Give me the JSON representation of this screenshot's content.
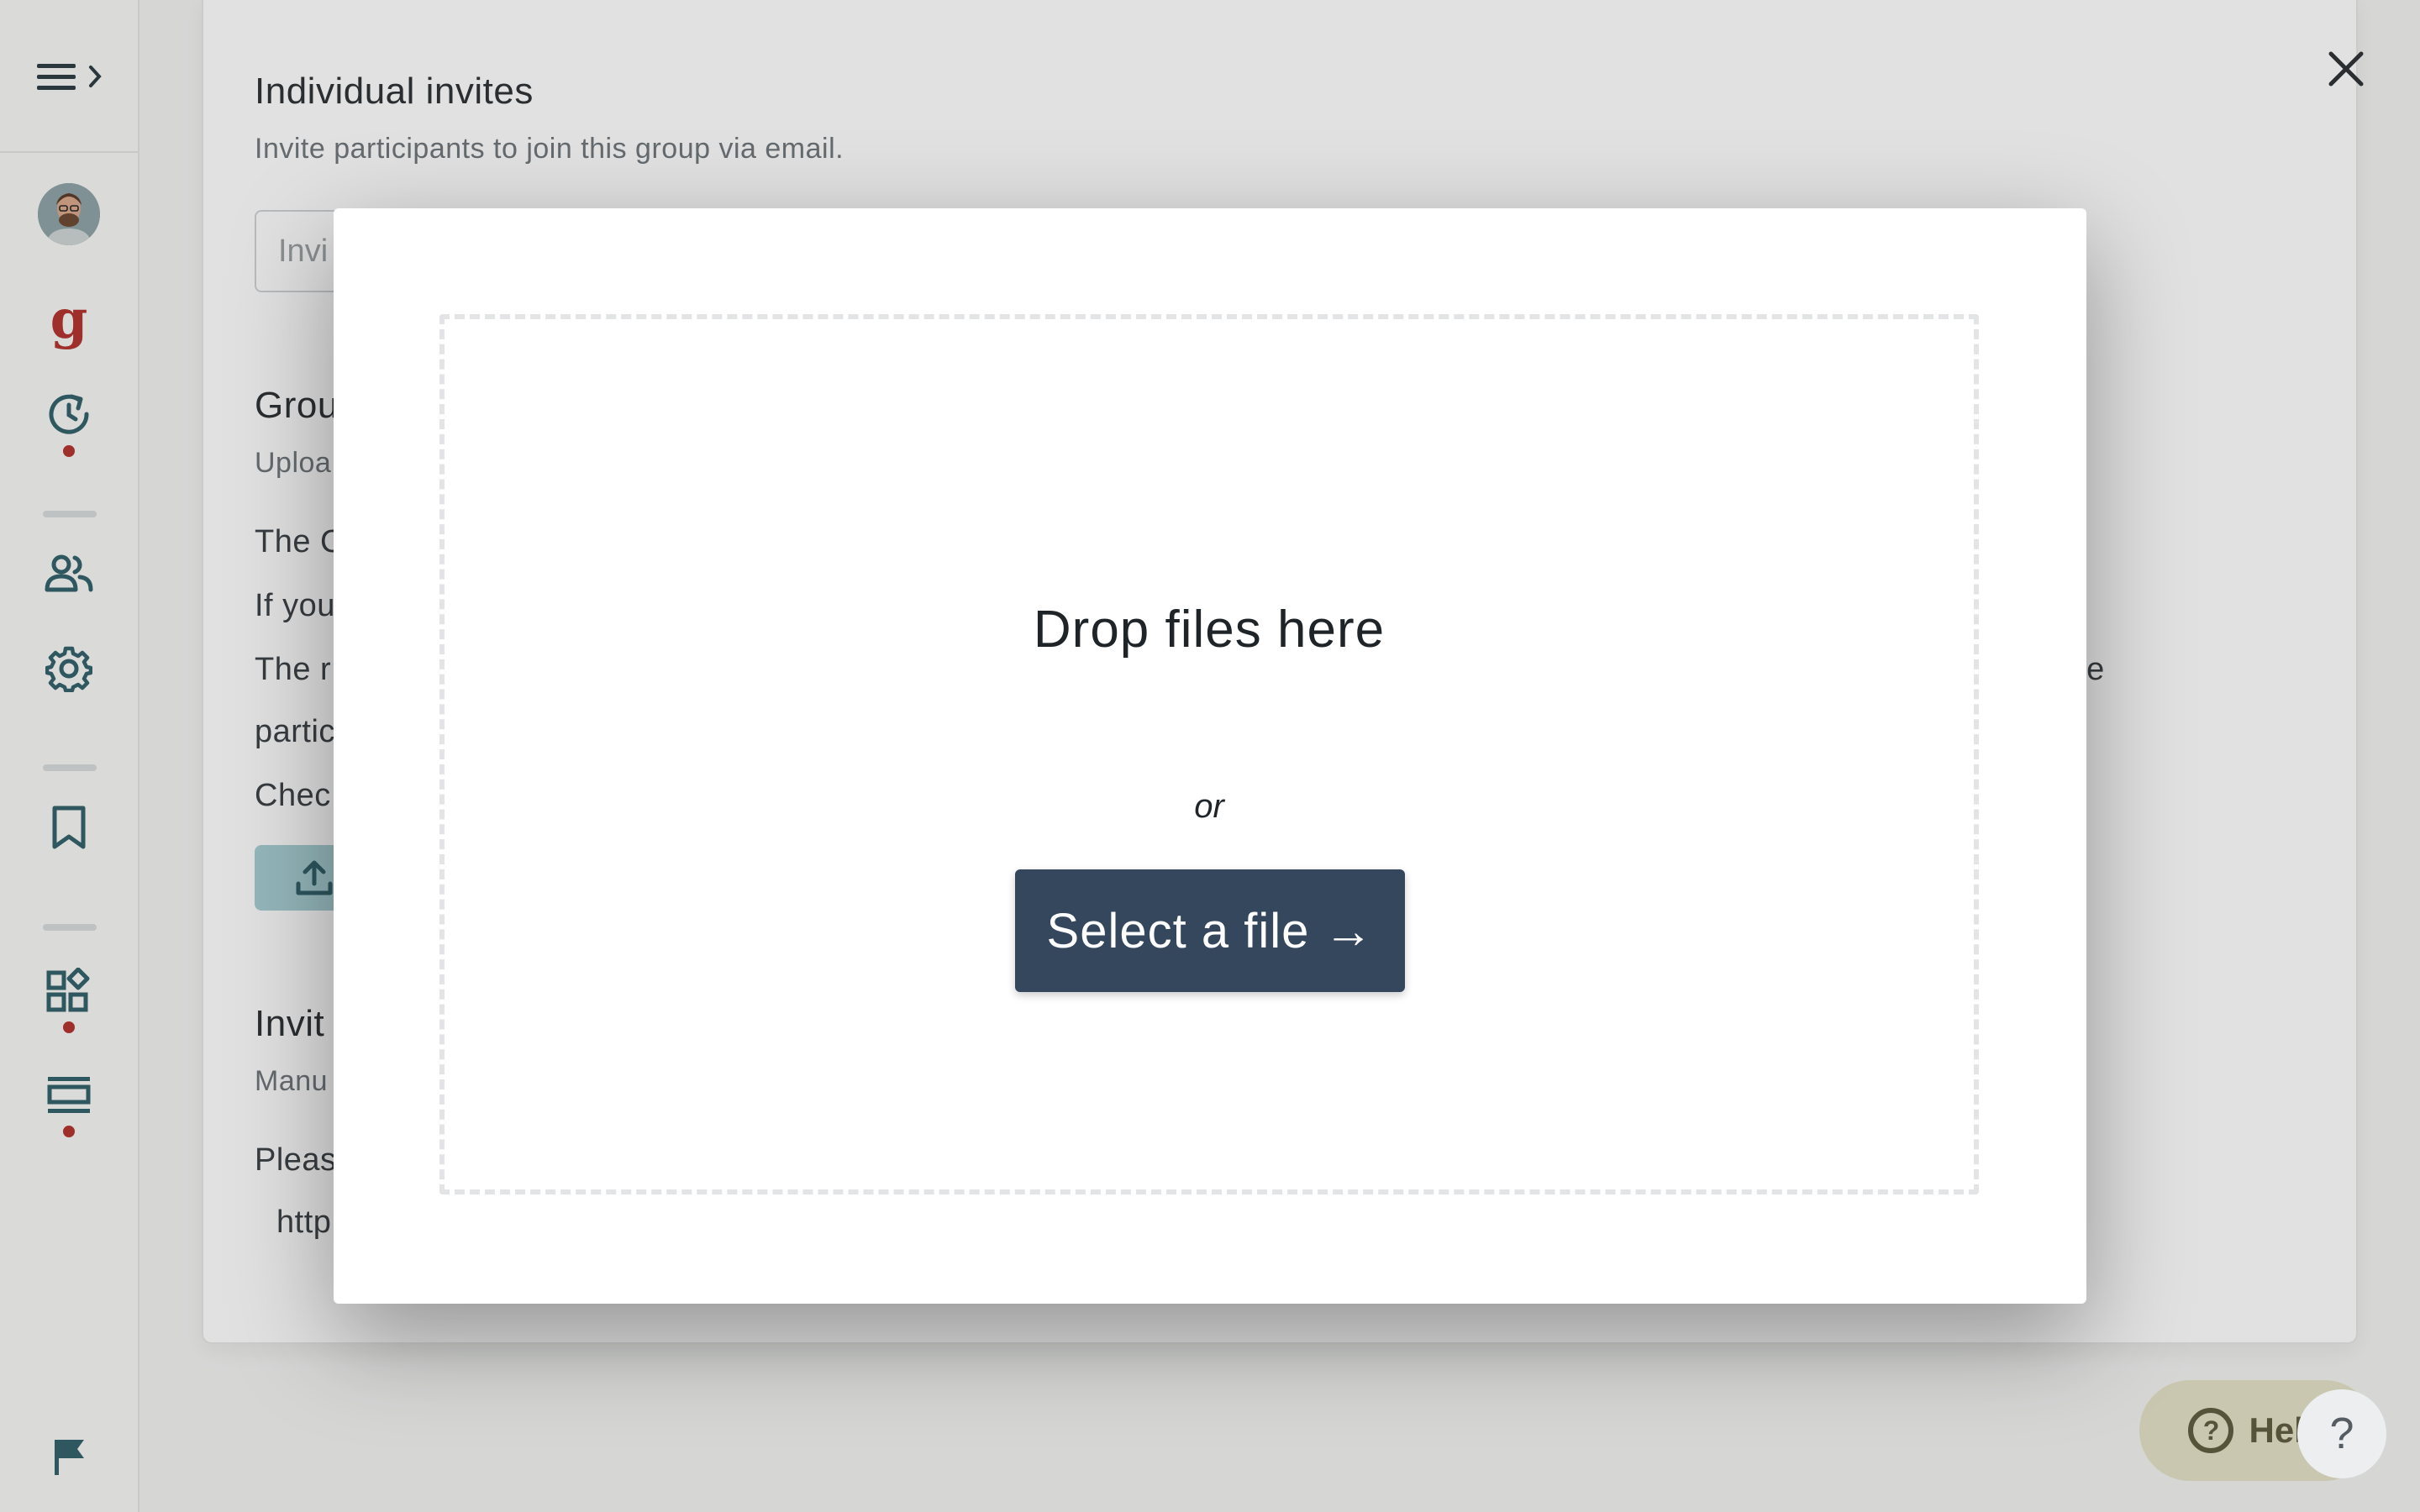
{
  "sidebar": {
    "menu_icon": "menu-chevron-icon",
    "items": [
      {
        "name": "user-avatar",
        "icon": "avatar"
      },
      {
        "name": "brand-logo",
        "icon": "g-logo-icon",
        "glyph": "g"
      },
      {
        "name": "history",
        "icon": "history-icon",
        "has_dot": true
      },
      {
        "name": "participants",
        "icon": "people-icon"
      },
      {
        "name": "settings",
        "icon": "gear-icon"
      },
      {
        "name": "bookmark",
        "icon": "bookmark-icon"
      },
      {
        "name": "widgets",
        "icon": "widgets-icon",
        "has_dot": true
      },
      {
        "name": "layout",
        "icon": "layout-icon",
        "has_dot": true
      },
      {
        "name": "flag",
        "icon": "flag-icon"
      }
    ],
    "accent_color": "#2f5f68",
    "dot_color": "#b3302b"
  },
  "main": {
    "individual": {
      "title": "Individual invites",
      "subtitle": "Invite participants to join this group via email.",
      "input_value": "Invi"
    },
    "group": {
      "title": "Grou",
      "subtitle": "Uploa",
      "lines": [
        "The C",
        "If you",
        "The r",
        "partic",
        "Chec"
      ],
      "line3_tail": "re"
    },
    "invite": {
      "title": "Invit",
      "subtitle": "Manu",
      "line": "Pleas",
      "link": "http"
    }
  },
  "modal": {
    "drop_title": "Drop files here",
    "or_text": "or",
    "select_button": "Select a file →",
    "help_glyph": "?"
  },
  "help_button": {
    "label": "Help",
    "glyph": "?"
  },
  "colors": {
    "button_dark": "#35475c",
    "help_bg": "#e4e1c6",
    "upload_btn": "#a6cfd3"
  }
}
